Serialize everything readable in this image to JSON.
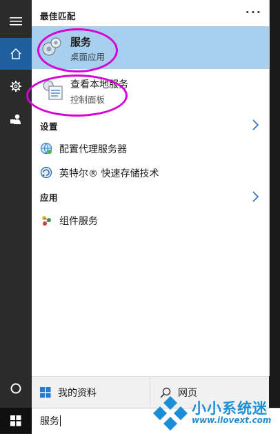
{
  "best_match": {
    "header": "最佳匹配",
    "more_label": "···",
    "item": {
      "title": "服务",
      "subtitle": "桌面应用",
      "icon": "services-gear-icon"
    },
    "second_item": {
      "title": "查看本地服务",
      "subtitle": "控制面板",
      "icon": "control-panel-services-icon"
    }
  },
  "settings": {
    "header": "设置",
    "items": [
      {
        "label": "配置代理服务器",
        "icon": "proxy-globe-icon"
      },
      {
        "label": "英特尔® 快速存储技术",
        "icon": "intel-storage-icon"
      }
    ]
  },
  "apps": {
    "header": "应用",
    "items": [
      {
        "label": "组件服务",
        "icon": "component-services-icon"
      }
    ]
  },
  "bottom": {
    "my_stuff_label": "我的资料",
    "web_label": "网页"
  },
  "search": {
    "query": "服务"
  },
  "watermark": {
    "brand": "小小系统迷",
    "url": "www.ilovext.com"
  },
  "colors": {
    "accent_highlight": "#a8cfee",
    "rail": "#2b2b2b",
    "home_active": "#1e5f9e",
    "annotation": "#d400d4",
    "watermark": "#1a8fd8"
  }
}
